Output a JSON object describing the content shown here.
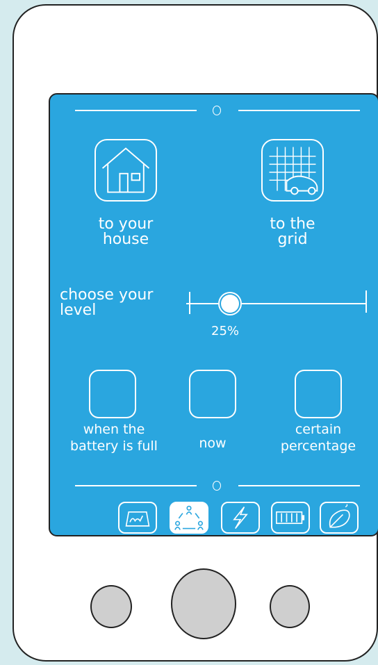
{
  "options": {
    "house_label": [
      "to your",
      "house"
    ],
    "grid_label": [
      "to the",
      "grid"
    ]
  },
  "level": {
    "label": [
      "choose your",
      "level"
    ],
    "percent_text": "25%",
    "value_fraction": 0.25
  },
  "timing": {
    "battery_full_label": [
      "when the",
      "battery is full"
    ],
    "now_label": "now",
    "percentage_label": [
      "certain",
      "percentage"
    ]
  },
  "tabs": [
    {
      "icon": "dashboard-icon",
      "active": false
    },
    {
      "icon": "sharing-cycle-icon",
      "active": true
    },
    {
      "icon": "lightning-icon",
      "active": false
    },
    {
      "icon": "battery-icon",
      "active": false
    },
    {
      "icon": "eco-leaf-icon",
      "active": false
    }
  ],
  "colors": {
    "screen": "#2aa6df",
    "background": "#d5ebee",
    "hardware_button": "#cfcfcf"
  }
}
